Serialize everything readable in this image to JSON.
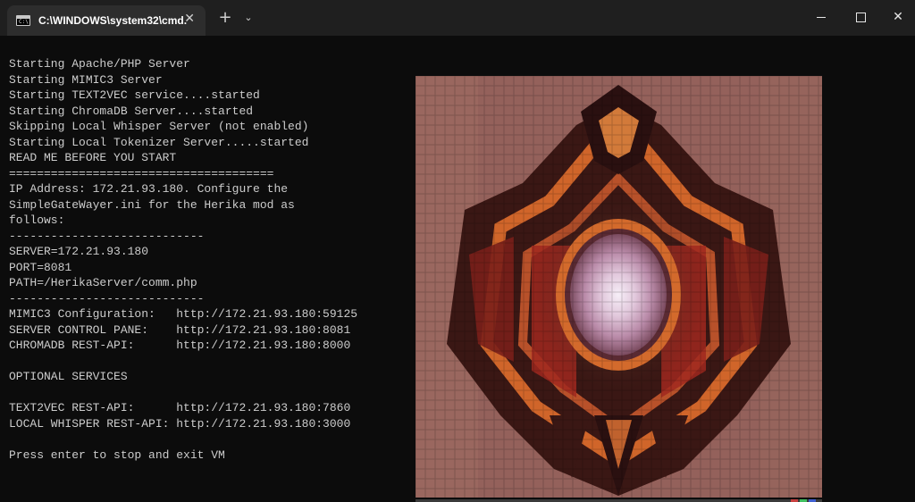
{
  "window": {
    "tab_title": "C:\\WINDOWS\\system32\\cmd.",
    "tab_icon": "cmd-icon",
    "tab_icon_text": "C:\\",
    "close_tab_glyph": "✕",
    "new_tab_glyph": "+",
    "dropdown_glyph": "⌄",
    "close_window_glyph": "✕"
  },
  "terminal": {
    "lines": [
      "Starting Apache/PHP Server",
      "Starting MIMIC3 Server",
      "Starting TEXT2VEC service....started",
      "Starting ChromaDB Server....started",
      "Skipping Local Whisper Server (not enabled)",
      "Starting Local Tokenizer Server.....started",
      "READ ME BEFORE YOU START",
      "======================================",
      "IP Address: 172.21.93.180. Configure the",
      "SimpleGateWayer.ini for the Herika mod as",
      "follows:",
      "----------------------------",
      "SERVER=172.21.93.180",
      "PORT=8081",
      "PATH=/HerikaServer/comm.php",
      "----------------------------",
      "MIMIC3 Configuration:   http://172.21.93.180:59125",
      "SERVER CONTROL PANE:    http://172.21.93.180:8081",
      "CHROMADB REST-API:      http://172.21.93.180:8000",
      "",
      "OPTIONAL SERVICES",
      "",
      "TEXT2VEC REST-API:      http://172.21.93.180:7860",
      "LOCAL WHISPER REST-API: http://172.21.93.180:3000",
      "",
      "Press enter to stop and exit VM"
    ]
  },
  "colors": {
    "terminal_bg": "#0c0c0c",
    "terminal_fg": "#cccccc",
    "titlebar_bg": "#1f1f1f",
    "tab_bg": "#2d2d2d"
  }
}
